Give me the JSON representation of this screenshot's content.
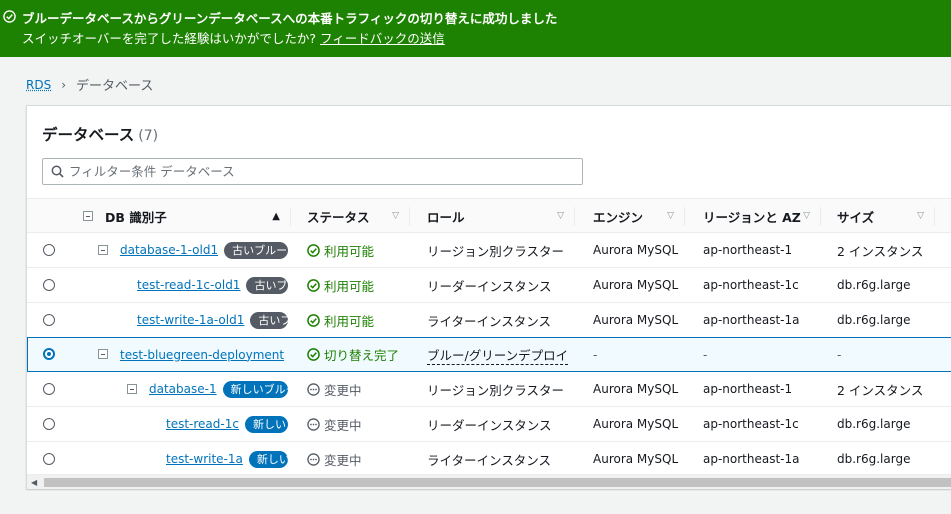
{
  "banner": {
    "title": "ブルーデータベースからグリーンデータベースへの本番トラフィックの切り替えに成功しました",
    "subtitle": "スイッチオーバーを完了した経験はいかがでしたか?",
    "feedback_link": "フィードバックの送信",
    "color": "#1d8102",
    "icon": "check-circle-icon"
  },
  "breadcrumb": {
    "root": "RDS",
    "current": "データベース"
  },
  "panel": {
    "title": "データベース",
    "count": "(7)",
    "search_placeholder": "フィルター条件 データベース"
  },
  "columns": {
    "db_id": "DB 識別子",
    "status": "ステータス",
    "role": "ロール",
    "engine": "エンジン",
    "region": "リージョンと AZ",
    "size": "サイズ"
  },
  "rows": [
    {
      "id": "database-1-old1",
      "badge": "古いブルー",
      "status": "利用可能",
      "role": "リージョン別クラスター",
      "engine": "Aurora MySQL",
      "region": "ap-northeast-1",
      "size": "2 インスタンス"
    },
    {
      "id": "test-read-1c-old1",
      "badge": "古いブルー",
      "status": "利用可能",
      "role": "リーダーインスタンス",
      "engine": "Aurora MySQL",
      "region": "ap-northeast-1c",
      "size": "db.r6g.large"
    },
    {
      "id": "test-write-1a-old1",
      "badge": "古いブルー",
      "status": "利用可能",
      "role": "ライターインスタンス",
      "engine": "Aurora MySQL",
      "region": "ap-northeast-1a",
      "size": "db.r6g.large"
    },
    {
      "id": "test-bluegreen-deployment",
      "badge": "",
      "status": "切り替え完了",
      "role": "ブルー/グリーンデプロイ",
      "engine": "-",
      "region": "-",
      "size": "-"
    },
    {
      "id": "database-1",
      "badge": "新しいブルー",
      "status": "変更中",
      "role": "リージョン別クラスター",
      "engine": "Aurora MySQL",
      "region": "ap-northeast-1",
      "size": "2 インスタンス"
    },
    {
      "id": "test-read-1c",
      "badge": "新しいブルー",
      "status": "変更中",
      "role": "リーダーインスタンス",
      "engine": "Aurora MySQL",
      "region": "ap-northeast-1c",
      "size": "db.r6g.large"
    },
    {
      "id": "test-write-1a",
      "badge": "新しいブルー",
      "status": "変更中",
      "role": "ライターインスタンス",
      "engine": "Aurora MySQL",
      "region": "ap-northeast-1a",
      "size": "db.r6g.large"
    }
  ],
  "selected_row": "test-bluegreen-deployment",
  "colors": {
    "link": "#0073bb",
    "status_ok": "#1d8102",
    "badge_old": "#545b64",
    "badge_new": "#0073bb"
  }
}
